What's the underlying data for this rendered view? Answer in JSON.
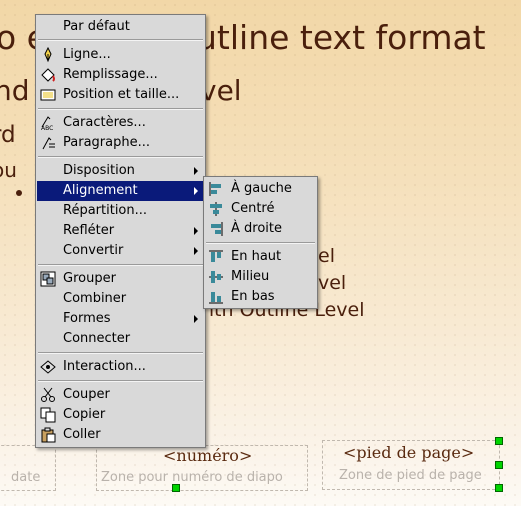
{
  "slide": {
    "title_left": "o e",
    "title_right": "utline text format",
    "level1_left": "nd",
    "level1_right": "vel",
    "level2_left": "rd",
    "level3_left": "ou",
    "level3_right": "l",
    "line_a": "el",
    "line_b": "vel",
    "line_c": "nth Outline Level",
    "footer_date_hint": "date",
    "footer_number_title": "<numéro>",
    "footer_number_hint": "Zone pour numéro de diapo",
    "footer_page_title": "<pied de page>",
    "footer_page_hint": "Zone de pied de page"
  },
  "context_menu": {
    "items": [
      {
        "label": "Par défaut",
        "icon": ""
      },
      {
        "label": "Ligne...",
        "icon": "line-pen-icon"
      },
      {
        "label": "Remplissage...",
        "icon": "paint-bucket-icon"
      },
      {
        "label": "Position et taille...",
        "icon": "position-size-icon"
      },
      {
        "label": "Caractères...",
        "icon": "character-icon"
      },
      {
        "label": "Paragraphe...",
        "icon": "paragraph-icon"
      },
      {
        "label": "Disposition",
        "icon": ""
      },
      {
        "label": "Alignement",
        "icon": ""
      },
      {
        "label": "Répartition...",
        "icon": ""
      },
      {
        "label": "Refléter",
        "icon": ""
      },
      {
        "label": "Convertir",
        "icon": ""
      },
      {
        "label": "Grouper",
        "icon": "group-icon"
      },
      {
        "label": "Combiner",
        "icon": ""
      },
      {
        "label": "Formes",
        "icon": ""
      },
      {
        "label": "Connecter",
        "icon": ""
      },
      {
        "label": "Interaction...",
        "icon": "interaction-icon"
      },
      {
        "label": "Couper",
        "icon": "scissors-icon"
      },
      {
        "label": "Copier",
        "icon": "copy-icon"
      },
      {
        "label": "Coller",
        "icon": "paste-icon"
      }
    ]
  },
  "alignment_submenu": {
    "items": [
      {
        "label": "À gauche",
        "icon": "align-left-icon"
      },
      {
        "label": "Centré",
        "icon": "align-center-icon"
      },
      {
        "label": "À droite",
        "icon": "align-right-icon"
      },
      {
        "label": "En haut",
        "icon": "align-top-icon"
      },
      {
        "label": "Milieu",
        "icon": "align-middle-icon"
      },
      {
        "label": "En bas",
        "icon": "align-bottom-icon"
      }
    ]
  },
  "colors": {
    "menu_bg": "#d9d9d9",
    "highlight": "#0a1a7a",
    "slide_text": "#4a1f0c"
  }
}
